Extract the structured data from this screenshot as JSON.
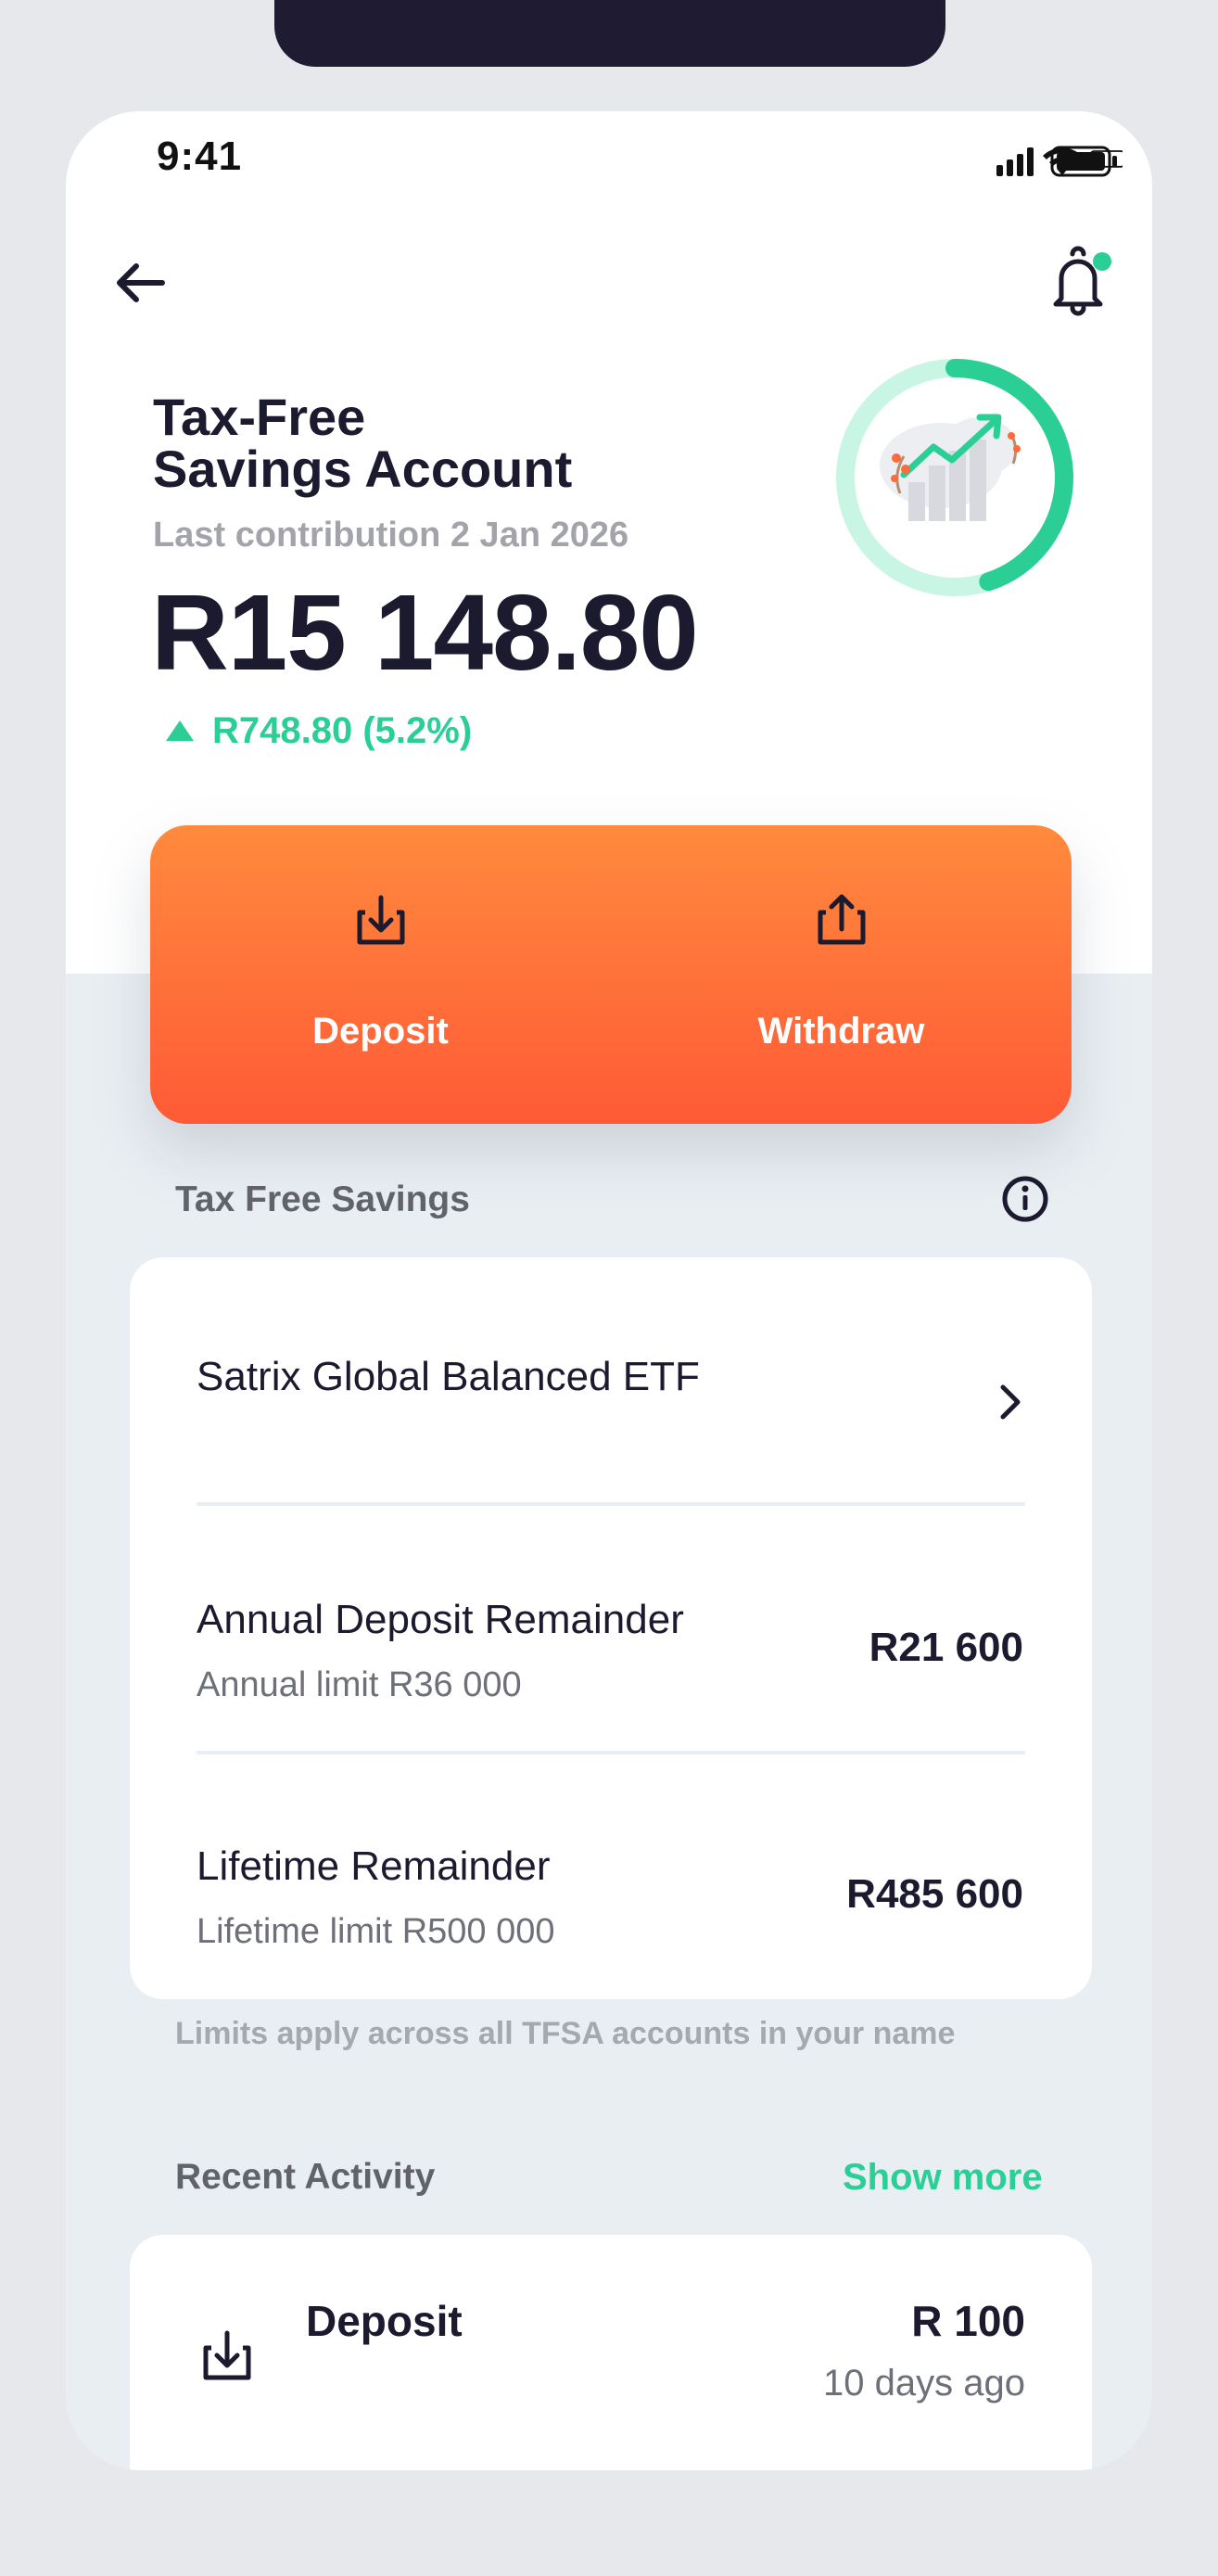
{
  "status_bar": {
    "time": "9:41"
  },
  "header": {
    "title_line1": "Tax-Free",
    "title_line2": "Savings Account",
    "last_contribution": "Last contribution 2 Jan 2026",
    "balance": "R15 148.80",
    "change": "R748.80 (5.2%)",
    "progress_ring_level": 0.45
  },
  "actions": {
    "deposit_label": "Deposit",
    "withdraw_label": "Withdraw"
  },
  "tax_free_section": {
    "label": "Tax Free Savings",
    "fund_name": "Satrix Global Balanced ETF",
    "annual": {
      "title": "Annual Deposit Remainder",
      "limit": "Annual limit R36 000",
      "amount": "R21 600"
    },
    "lifetime": {
      "title": "Lifetime Remainder",
      "limit": "Lifetime limit R500 000",
      "amount": "R485 600"
    },
    "footnote": "Limits apply across all TFSA accounts in your name"
  },
  "recent_activity": {
    "label": "Recent Activity",
    "show_more": "Show more",
    "items": [
      {
        "title": "Deposit",
        "amount": "R 100",
        "time": "10 days ago"
      }
    ]
  },
  "colors": {
    "accent_green": "#2bcf96",
    "action_orange_top": "#ff8a3d",
    "action_orange_bottom": "#ff5a36",
    "dark_text": "#1c1a2e"
  }
}
